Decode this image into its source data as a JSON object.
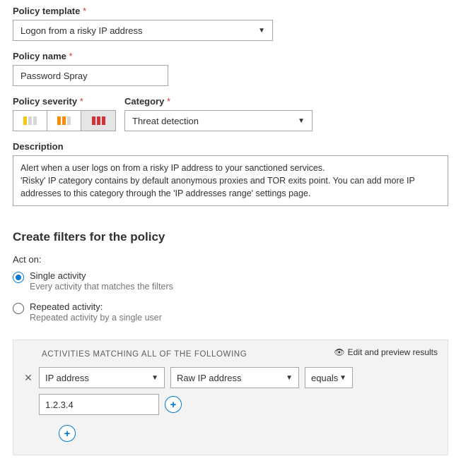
{
  "labels": {
    "policy_template": "Policy template",
    "policy_name": "Policy name",
    "policy_severity": "Policy severity",
    "category": "Category",
    "description": "Description"
  },
  "values": {
    "policy_template": "Logon from a risky IP address",
    "policy_name": "Password Spray",
    "category": "Threat detection",
    "description_line1": "Alert when a user logs on from a risky IP address to your sanctioned services.",
    "description_line2": "'Risky' IP category contains by default anonymous proxies and TOR exits point. You can add more IP addresses to this category through the 'IP addresses range' settings page."
  },
  "filters_section": {
    "title": "Create filters for the policy",
    "act_on": "Act on:",
    "opt_single_title": "Single activity",
    "opt_single_sub": "Every activity that matches the filters",
    "opt_repeated_title": "Repeated activity:",
    "opt_repeated_sub": "Repeated activity by a single user"
  },
  "filter_panel": {
    "preview": "Edit and preview results",
    "matching_title": "ACTIVITIES MATCHING ALL OF THE FOLLOWING",
    "field1": "IP address",
    "field2": "Raw IP address",
    "operator": "equals",
    "value": "1.2.3.4"
  }
}
